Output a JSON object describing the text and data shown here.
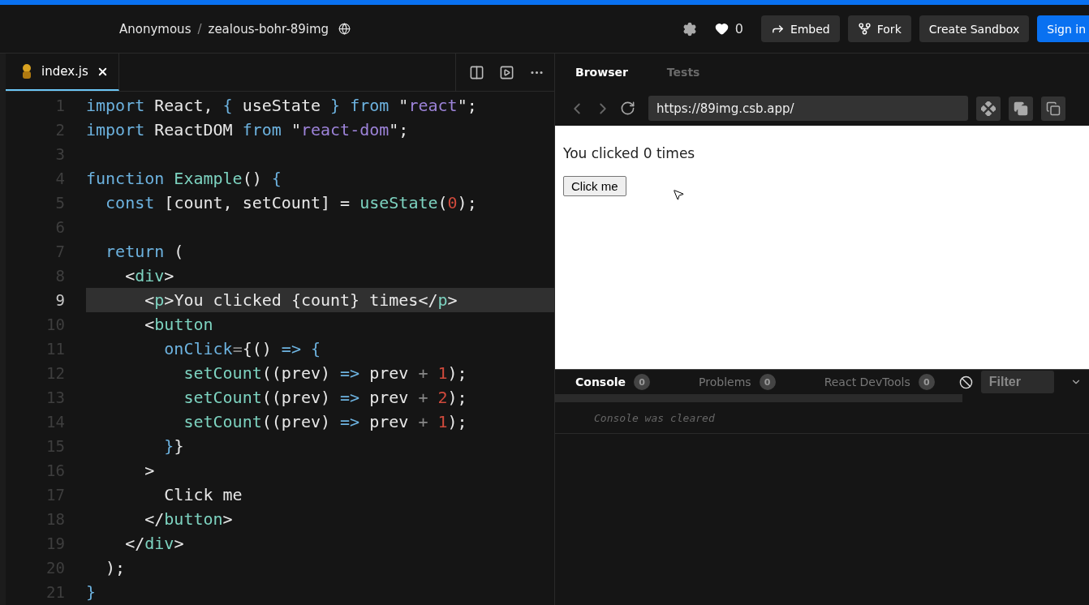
{
  "header": {
    "owner": "Anonymous",
    "separator": "/",
    "sandbox_name": "zealous-bohr-89img",
    "likes": "0",
    "buttons": [
      {
        "label": "Embed",
        "kind": "embed"
      },
      {
        "label": "Fork",
        "kind": "fork"
      },
      {
        "label": "Create Sandbox",
        "kind": "plain"
      },
      {
        "label": "Sign in",
        "kind": "primary"
      }
    ]
  },
  "editor": {
    "tabs": [
      {
        "label": "index.js",
        "selected": true
      }
    ],
    "lines": [
      {
        "number": "1",
        "current": false,
        "tokens": [
          {
            "kind": "keyword",
            "text": "import"
          },
          {
            "kind": "plain",
            "text": " React, "
          },
          {
            "kind": "keyword",
            "text": "{"
          },
          {
            "kind": "plain",
            "text": " useState "
          },
          {
            "kind": "keyword",
            "text": "}"
          },
          {
            "kind": "keyword",
            "text": " from"
          },
          {
            "kind": "plain",
            "text": " \""
          },
          {
            "kind": "string",
            "text": "react"
          },
          {
            "kind": "plain",
            "text": "\";"
          }
        ]
      },
      {
        "number": "2",
        "current": false,
        "tokens": [
          {
            "kind": "keyword",
            "text": "import"
          },
          {
            "kind": "plain",
            "text": " ReactDOM "
          },
          {
            "kind": "keyword",
            "text": "from"
          },
          {
            "kind": "plain",
            "text": " \""
          },
          {
            "kind": "string",
            "text": "react-dom"
          },
          {
            "kind": "plain",
            "text": "\";"
          }
        ]
      },
      {
        "number": "3",
        "current": false
      },
      {
        "number": "4",
        "current": false,
        "tokens": [
          {
            "kind": "keyword",
            "text": "function"
          },
          {
            "kind": "function",
            "text": " Example"
          },
          {
            "kind": "plain",
            "text": "() "
          },
          {
            "kind": "keyword",
            "text": "{"
          }
        ]
      },
      {
        "number": "5",
        "current": false,
        "tokens": [
          {
            "kind": "keyword",
            "text": "  const"
          },
          {
            "kind": "plain",
            "text": " [count, setCount] = "
          },
          {
            "kind": "function",
            "text": "useState"
          },
          {
            "kind": "plain",
            "text": "("
          },
          {
            "kind": "number",
            "text": "0"
          },
          {
            "kind": "plain",
            "text": ");"
          }
        ]
      },
      {
        "number": "6",
        "current": false
      },
      {
        "number": "7",
        "current": false,
        "tokens": [
          {
            "kind": "keyword",
            "text": "  return"
          },
          {
            "kind": "plain",
            "text": " ("
          }
        ]
      },
      {
        "number": "8",
        "current": false,
        "tokens": [
          {
            "kind": "plain",
            "text": "    <"
          },
          {
            "kind": "function",
            "text": "div"
          },
          {
            "kind": "plain",
            "text": ">"
          }
        ]
      },
      {
        "number": "9",
        "current": true,
        "tokens": [
          {
            "kind": "plain",
            "text": "      <"
          },
          {
            "kind": "function",
            "text": "p"
          },
          {
            "kind": "plain",
            "text": ">You clicked {count} times</"
          },
          {
            "kind": "function",
            "text": "p"
          },
          {
            "kind": "plain",
            "text": ">"
          }
        ]
      },
      {
        "number": "10",
        "current": false,
        "tokens": [
          {
            "kind": "plain",
            "text": "      <"
          },
          {
            "kind": "function",
            "text": "button"
          }
        ]
      },
      {
        "number": "11",
        "current": false,
        "tokens": [
          {
            "kind": "keyword",
            "text": "        onClick"
          },
          {
            "kind": "operator",
            "text": "="
          },
          {
            "kind": "plain",
            "text": "{() "
          },
          {
            "kind": "keyword",
            "text": "=> {"
          }
        ]
      },
      {
        "number": "12",
        "current": false,
        "tokens": [
          {
            "kind": "function",
            "text": "          setCount"
          },
          {
            "kind": "plain",
            "text": "((prev) "
          },
          {
            "kind": "keyword",
            "text": "=>"
          },
          {
            "kind": "plain",
            "text": " prev "
          },
          {
            "kind": "operator",
            "text": "+"
          },
          {
            "kind": "number",
            "text": " 1"
          },
          {
            "kind": "plain",
            "text": ");"
          }
        ]
      },
      {
        "number": "13",
        "current": false,
        "tokens": [
          {
            "kind": "function",
            "text": "          setCount"
          },
          {
            "kind": "plain",
            "text": "((prev) "
          },
          {
            "kind": "keyword",
            "text": "=>"
          },
          {
            "kind": "plain",
            "text": " prev "
          },
          {
            "kind": "operator",
            "text": "+"
          },
          {
            "kind": "number",
            "text": " 2"
          },
          {
            "kind": "plain",
            "text": ");"
          }
        ]
      },
      {
        "number": "14",
        "current": false,
        "tokens": [
          {
            "kind": "function",
            "text": "          setCount"
          },
          {
            "kind": "plain",
            "text": "((prev) "
          },
          {
            "kind": "keyword",
            "text": "=>"
          },
          {
            "kind": "plain",
            "text": " prev "
          },
          {
            "kind": "operator",
            "text": "+"
          },
          {
            "kind": "number",
            "text": " 1"
          },
          {
            "kind": "plain",
            "text": ");"
          }
        ]
      },
      {
        "number": "15",
        "current": false,
        "tokens": [
          {
            "kind": "keyword",
            "text": "        }"
          },
          {
            "kind": "plain",
            "text": "}"
          }
        ]
      },
      {
        "number": "16",
        "current": false,
        "tokens": [
          {
            "kind": "plain",
            "text": "      >"
          }
        ]
      },
      {
        "number": "17",
        "current": false,
        "tokens": [
          {
            "kind": "plain",
            "text": "        Click me"
          }
        ]
      },
      {
        "number": "18",
        "current": false,
        "tokens": [
          {
            "kind": "plain",
            "text": "      </"
          },
          {
            "kind": "function",
            "text": "button"
          },
          {
            "kind": "plain",
            "text": ">"
          }
        ]
      },
      {
        "number": "19",
        "current": false,
        "tokens": [
          {
            "kind": "plain",
            "text": "    </"
          },
          {
            "kind": "function",
            "text": "div"
          },
          {
            "kind": "plain",
            "text": ">"
          }
        ]
      },
      {
        "number": "20",
        "current": false,
        "tokens": [
          {
            "kind": "plain",
            "text": "  );"
          }
        ]
      },
      {
        "number": "21",
        "current": false,
        "tokens": [
          {
            "kind": "keyword",
            "text": "}"
          }
        ]
      }
    ]
  },
  "preview": {
    "tabs": [
      {
        "label": "Browser",
        "selected": true
      },
      {
        "label": "Tests",
        "selected": false
      }
    ],
    "url": "https://89img.csb.app/",
    "page_text": "You clicked 0 times",
    "page_button": "Click me"
  },
  "console": {
    "tabs": [
      {
        "label": "Console",
        "count": "0",
        "selected": true
      },
      {
        "label": "Problems",
        "count": "0",
        "selected": false
      },
      {
        "label": "React DevTools",
        "count": "0",
        "selected": false
      }
    ],
    "filter_placeholder": "Filter",
    "messages": [
      "Console was cleared"
    ]
  }
}
